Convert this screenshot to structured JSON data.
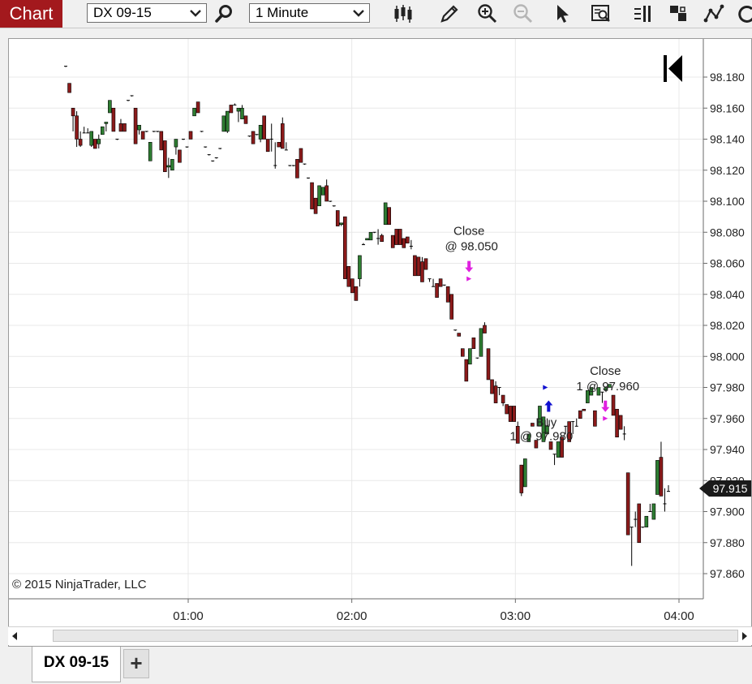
{
  "toolbar": {
    "title": "Chart",
    "instrument": "DX 09-15",
    "interval": "1 Minute",
    "icons": [
      "search-icon",
      "bar-type-icon",
      "pencil-icon",
      "zoom-in-icon",
      "zoom-out-icon",
      "cursor-icon",
      "data-box-icon",
      "layout-icon",
      "grid-icon",
      "indicator-icon",
      "refresh-icon"
    ]
  },
  "chart": {
    "copyright": "© 2015 NinjaTrader, LLC",
    "last_price": "97.915",
    "colors": {
      "up": "#2e7d32",
      "down": "#8b1a1a",
      "price_tag": "#1a1a1a",
      "marker_close": "#e020e0",
      "marker_buy": "#1010d0"
    }
  },
  "chart_data": {
    "type": "candlestick",
    "y_ticks": [
      "98.180",
      "98.160",
      "98.140",
      "98.120",
      "98.100",
      "98.080",
      "98.060",
      "98.040",
      "98.020",
      "98.000",
      "97.980",
      "97.960",
      "97.940",
      "97.920",
      "97.900",
      "97.880",
      "97.860"
    ],
    "x_ticks": [
      "01:00",
      "02:00",
      "03:00",
      "04:00"
    ],
    "ylim": [
      97.85,
      98.19
    ],
    "annotations": [
      {
        "label_line1": "Close",
        "label_line2": "@ 98.050",
        "kind": "close",
        "time": "02:43",
        "price": 98.05
      },
      {
        "label_line1": "Buy",
        "label_line2": "1 @ 97.980",
        "kind": "buy",
        "time": "03:11",
        "price": 97.98
      },
      {
        "label_line1": "Close",
        "label_line2": "1 @ 97.960",
        "kind": "close",
        "time": "03:33",
        "price": 97.96
      }
    ],
    "candles": [
      [
        98.187,
        98.187,
        98.187,
        98.187
      ],
      [
        98.176,
        98.176,
        98.17,
        98.17
      ],
      [
        98.16,
        98.16,
        98.145,
        98.155
      ],
      [
        98.155,
        98.158,
        98.135,
        98.14
      ],
      [
        98.14,
        98.145,
        98.135,
        98.136
      ],
      [
        98.144,
        98.148,
        98.144,
        98.144
      ],
      [
        98.144,
        98.147,
        98.144,
        98.144
      ],
      [
        98.136,
        98.145,
        98.135,
        98.145
      ],
      [
        98.14,
        98.14,
        98.134,
        98.134
      ],
      [
        98.137,
        98.143,
        98.134,
        98.14
      ],
      [
        98.143,
        98.148,
        98.143,
        98.148
      ],
      [
        98.15,
        98.151,
        98.145,
        98.151
      ],
      [
        98.157,
        98.165,
        98.157,
        98.165
      ],
      [
        98.16,
        98.16,
        98.145,
        98.145
      ],
      [
        98.14,
        98.14,
        98.14,
        98.14
      ],
      [
        98.15,
        98.153,
        98.145,
        98.145
      ],
      [
        98.15,
        98.15,
        98.145,
        98.145
      ],
      [
        98.165,
        98.165,
        98.165,
        98.165
      ],
      [
        98.168,
        98.168,
        98.168,
        98.168
      ],
      [
        98.16,
        98.16,
        98.137,
        98.137
      ],
      [
        98.146,
        98.149,
        98.143,
        98.149
      ],
      [
        98.145,
        98.145,
        98.14,
        98.14
      ],
      [
        98.145,
        98.145,
        98.145,
        98.145
      ],
      [
        98.126,
        98.138,
        98.126,
        98.138
      ],
      [
        98.145,
        98.145,
        98.145,
        98.145
      ],
      [
        98.145,
        98.145,
        98.145,
        98.145
      ],
      [
        98.145,
        98.145,
        98.133,
        98.133
      ],
      [
        98.139,
        98.139,
        98.119,
        98.119
      ],
      [
        98.122,
        98.128,
        98.115,
        98.123
      ],
      [
        98.12,
        98.127,
        98.12,
        98.127
      ],
      [
        98.135,
        98.14,
        98.13,
        98.14
      ],
      [
        98.133,
        98.133,
        98.125,
        98.125
      ],
      [
        98.14,
        98.14,
        98.14,
        98.14
      ],
      [
        98.135,
        98.135,
        98.135,
        98.135
      ],
      [
        98.145,
        98.145,
        98.14,
        98.14
      ],
      [
        98.155,
        98.16,
        98.155,
        98.16
      ],
      [
        98.164,
        98.164,
        98.157,
        98.157
      ],
      [
        98.145,
        98.145,
        98.145,
        98.145
      ],
      [
        98.135,
        98.135,
        98.135,
        98.135
      ],
      [
        98.13,
        98.13,
        98.13,
        98.13
      ],
      [
        98.126,
        98.126,
        98.126,
        98.126
      ],
      [
        98.128,
        98.128,
        98.128,
        98.128
      ],
      [
        98.134,
        98.134,
        98.134,
        98.134
      ],
      [
        98.145,
        98.155,
        98.145,
        98.155
      ],
      [
        98.145,
        98.158,
        98.144,
        98.158
      ],
      [
        98.162,
        98.162,
        98.157,
        98.157
      ],
      [
        98.162,
        98.163,
        98.162,
        98.162
      ],
      [
        98.158,
        98.16,
        98.151,
        98.16
      ],
      [
        98.153,
        98.162,
        98.153,
        98.16
      ],
      [
        98.155,
        98.155,
        98.15,
        98.15
      ],
      [
        98.142,
        98.142,
        98.142,
        98.142
      ],
      [
        98.145,
        98.145,
        98.137,
        98.137
      ],
      [
        98.143,
        98.143,
        98.143,
        98.143
      ],
      [
        98.14,
        98.149,
        98.138,
        98.149
      ],
      [
        98.155,
        98.155,
        98.14,
        98.14
      ],
      [
        98.14,
        98.14,
        98.132,
        98.132
      ],
      [
        98.14,
        98.15,
        98.132,
        98.14
      ],
      [
        98.123,
        98.138,
        98.121,
        98.123
      ],
      [
        98.138,
        98.138,
        98.135,
        98.135
      ],
      [
        98.15,
        98.154,
        98.134,
        98.134
      ],
      [
        98.133,
        98.138,
        98.133,
        98.133
      ],
      [
        98.123,
        98.123,
        98.123,
        98.123
      ],
      [
        98.123,
        98.123,
        98.123,
        98.123
      ],
      [
        98.127,
        98.127,
        98.115,
        98.115
      ],
      [
        98.134,
        98.134,
        98.125,
        98.125
      ],
      [
        98.124,
        98.124,
        98.124,
        98.124
      ],
      [
        98.115,
        98.115,
        98.115,
        98.115
      ],
      [
        98.112,
        98.112,
        98.095,
        98.095
      ],
      [
        98.102,
        98.102,
        98.092,
        98.092
      ],
      [
        98.097,
        98.11,
        98.097,
        98.11
      ],
      [
        98.104,
        98.109,
        98.104,
        98.109
      ],
      [
        98.11,
        98.114,
        98.1,
        98.1
      ],
      [
        98.1,
        98.1,
        98.1,
        98.1
      ],
      [
        98.097,
        98.097,
        98.097,
        98.097
      ],
      [
        98.094,
        98.094,
        98.084,
        98.084
      ],
      [
        98.085,
        98.086,
        98.084,
        98.086
      ],
      [
        98.09,
        98.09,
        98.05,
        98.05
      ],
      [
        98.058,
        98.058,
        98.045,
        98.045
      ],
      [
        98.05,
        98.05,
        98.041,
        98.041
      ],
      [
        98.045,
        98.045,
        98.036,
        98.036
      ],
      [
        98.05,
        98.065,
        98.045,
        98.065
      ],
      [
        98.072,
        98.073,
        98.072,
        98.072
      ],
      [
        98.075,
        98.076,
        98.075,
        98.076
      ],
      [
        98.075,
        98.08,
        98.075,
        98.08
      ],
      [
        98.08,
        98.08,
        98.08,
        98.08
      ],
      [
        98.076,
        98.082,
        98.072,
        98.076
      ],
      [
        98.078,
        98.079,
        98.074,
        98.074
      ],
      [
        98.085,
        98.099,
        98.085,
        98.099
      ],
      [
        98.096,
        98.096,
        98.085,
        98.085
      ],
      [
        98.078,
        98.078,
        98.07,
        98.07
      ],
      [
        98.082,
        98.082,
        98.072,
        98.072
      ],
      [
        98.082,
        98.082,
        98.072,
        98.072
      ],
      [
        98.076,
        98.076,
        98.07,
        98.07
      ],
      [
        98.077,
        98.077,
        98.073,
        98.073
      ],
      [
        98.071,
        98.075,
        98.069,
        98.071
      ],
      [
        98.065,
        98.065,
        98.052,
        98.052
      ],
      [
        98.064,
        98.064,
        98.052,
        98.052
      ],
      [
        98.061,
        98.064,
        98.048,
        98.048
      ],
      [
        98.063,
        98.063,
        98.056,
        98.056
      ],
      [
        98.05,
        98.05,
        98.048,
        98.05
      ],
      [
        98.045,
        98.05,
        98.045,
        98.045
      ],
      [
        98.047,
        98.047,
        98.038,
        98.038
      ],
      [
        98.05,
        98.05,
        98.045,
        98.045
      ],
      [
        98.046,
        98.046,
        98.046,
        98.046
      ],
      [
        98.045,
        98.045,
        98.035,
        98.035
      ],
      [
        98.04,
        98.04,
        98.024,
        98.024
      ],
      [
        98.017,
        98.017,
        98.017,
        98.017
      ],
      [
        98.015,
        98.015,
        98.013,
        98.013
      ],
      [
        98.005,
        98.005,
        98.0,
        98.0
      ],
      [
        97.998,
        97.998,
        97.984,
        97.984
      ],
      [
        97.995,
        98.005,
        97.995,
        98.005
      ],
      [
        98.012,
        98.012,
        98.005,
        98.005
      ],
      [
        97.999,
        97.999,
        97.999,
        97.999
      ],
      [
        98.0,
        98.018,
        98.0,
        98.018
      ],
      [
        98.02,
        98.022,
        98.015,
        98.015
      ],
      [
        98.005,
        98.005,
        97.985,
        97.985
      ],
      [
        97.985,
        97.985,
        97.976,
        97.976
      ],
      [
        97.981,
        97.984,
        97.97,
        97.97
      ],
      [
        97.98,
        97.98,
        97.975,
        97.98
      ],
      [
        97.975,
        97.975,
        97.968,
        97.97
      ],
      [
        97.969,
        97.969,
        97.963,
        97.963
      ],
      [
        97.968,
        97.968,
        97.958,
        97.958
      ],
      [
        97.968,
        97.968,
        97.958,
        97.958
      ],
      [
        97.955,
        97.958,
        97.944,
        97.944
      ],
      [
        97.93,
        97.93,
        97.91,
        97.912
      ],
      [
        97.916,
        97.934,
        97.916,
        97.934
      ],
      [
        97.945,
        97.95,
        97.945,
        97.95
      ],
      [
        97.957,
        97.957,
        97.955,
        97.955
      ],
      [
        97.946,
        97.946,
        97.941,
        97.941
      ],
      [
        97.955,
        97.968,
        97.955,
        97.968
      ],
      [
        97.945,
        97.961,
        97.945,
        97.961
      ],
      [
        97.95,
        97.96,
        97.95,
        97.955
      ],
      [
        97.945,
        97.945,
        97.94,
        97.94
      ],
      [
        97.937,
        97.937,
        97.93,
        97.937
      ],
      [
        97.935,
        97.945,
        97.935,
        97.945
      ],
      [
        97.948,
        97.948,
        97.935,
        97.935
      ],
      [
        97.955,
        97.955,
        97.95,
        97.955
      ],
      [
        97.958,
        97.958,
        97.945,
        97.945
      ],
      [
        97.958,
        97.958,
        97.95,
        97.958
      ],
      [
        97.955,
        97.96,
        97.955,
        97.955
      ],
      [
        97.965,
        97.965,
        97.96,
        97.96
      ],
      [
        97.966,
        97.966,
        97.965,
        97.965
      ],
      [
        97.97,
        97.978,
        97.97,
        97.978
      ],
      [
        97.975,
        97.98,
        97.975,
        97.98
      ],
      [
        97.965,
        97.965,
        97.955,
        97.955
      ],
      [
        97.975,
        97.98,
        97.975,
        97.98
      ],
      [
        97.977,
        97.977,
        97.97,
        97.977
      ],
      [
        97.978,
        97.98,
        97.977,
        97.98
      ],
      [
        97.98,
        97.982,
        97.98,
        97.982
      ],
      [
        97.975,
        97.975,
        97.962,
        97.962
      ],
      [
        97.966,
        97.966,
        97.948,
        97.948
      ],
      [
        97.962,
        97.962,
        97.953,
        97.953
      ],
      [
        97.95,
        97.955,
        97.946,
        97.95
      ],
      [
        97.925,
        97.925,
        97.885,
        97.885
      ],
      [
        97.89,
        97.89,
        97.865,
        97.89
      ],
      [
        97.895,
        97.9,
        97.89,
        97.895
      ],
      [
        97.905,
        97.905,
        97.88,
        97.88
      ],
      [
        97.89,
        97.89,
        97.89,
        97.89
      ],
      [
        97.89,
        97.897,
        97.89,
        97.897
      ],
      [
        97.9,
        97.905,
        97.9,
        97.9
      ],
      [
        97.895,
        97.905,
        97.895,
        97.905
      ],
      [
        97.911,
        97.933,
        97.911,
        97.933
      ],
      [
        97.935,
        97.945,
        97.91,
        97.91
      ],
      [
        97.905,
        97.915,
        97.9,
        97.905
      ],
      [
        97.913,
        97.917,
        97.913,
        97.913
      ]
    ]
  }
}
